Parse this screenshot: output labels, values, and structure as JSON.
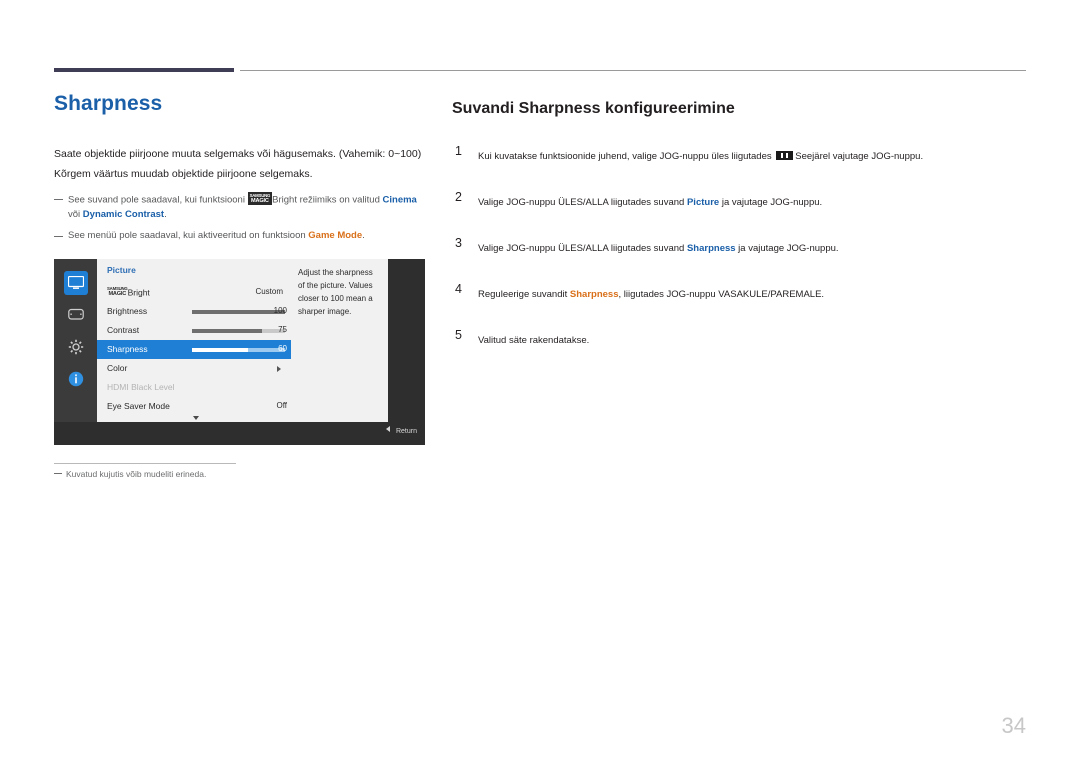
{
  "left": {
    "title": "Sharpness",
    "paragraphs": [
      "Saate objektide piirjoone muuta selgemaks või hägusemaks. (Vahemik: 0~100)",
      "Kõrgem väärtus muudab objektide piirjoone selgemaks."
    ],
    "notes": [
      {
        "pre": "See suvand pole saadaval, kui funktsiooni ",
        "tag_top": "SAMSUNG",
        "tag_bottom": "MAGIC",
        "mid": "Bright režiimiks on valitud ",
        "b1": "Cinema",
        "between": " või ",
        "b2": "Dynamic Contrast",
        "post": "."
      },
      {
        "pre": "See menüü pole saadaval, kui aktiveeritud on funktsioon ",
        "b1": "Game Mode",
        "post": "."
      }
    ],
    "footnote": "Kuvatud kujutis võib mudeliti erineda."
  },
  "osd": {
    "menu_title": "Picture",
    "icons": [
      {
        "name": "display-icon",
        "selected": true
      },
      {
        "name": "screen-adjust-icon",
        "selected": false
      },
      {
        "name": "gear-icon",
        "selected": false
      },
      {
        "name": "info-icon",
        "selected": false
      }
    ],
    "rows": [
      {
        "label_prefix_top": "SAMSUNG",
        "label_prefix_bottom": "MAGIC",
        "label": "Bright",
        "value": "Custom",
        "type": "text"
      },
      {
        "label": "Brightness",
        "value": "100",
        "type": "bar",
        "fill": 100
      },
      {
        "label": "Contrast",
        "value": "75",
        "type": "bar",
        "fill": 75
      },
      {
        "label": "Sharpness",
        "value": "60",
        "type": "bar",
        "fill": 60,
        "selected": true
      },
      {
        "label": "Color",
        "value": "",
        "type": "arrow"
      },
      {
        "label": "HDMI Black Level",
        "value": "",
        "type": "disabled"
      },
      {
        "label": "Eye Saver Mode",
        "value": "Off",
        "type": "text"
      }
    ],
    "help_text": "Adjust the sharpness of the picture. Values closer to 100 mean a sharper image.",
    "return_label": "Return"
  },
  "right": {
    "title": "Suvandi Sharpness konfigureerimine",
    "steps": [
      {
        "num": "1",
        "a": "Kui kuvatakse funktsioonide juhend, valige JOG-nuppu üles liigutades ",
        "b": "Seejärel vajutage JOG-nuppu."
      },
      {
        "num": "2",
        "a": "Valige JOG-nuppu ÜLES/ALLA liigutades suvand ",
        "bold": "Picture",
        "b": " ja vajutage JOG-nuppu."
      },
      {
        "num": "3",
        "a": "Valige JOG-nuppu ÜLES/ALLA liigutades suvand ",
        "bold": "Sharpness",
        "b": " ja vajutage JOG-nuppu."
      },
      {
        "num": "4",
        "a": "Reguleerige suvandit ",
        "bold": "Sharpness",
        "b": ", liigutades JOG-nuppu VASAKULE/PAREMALE."
      },
      {
        "num": "5",
        "a": "Valitud säte rakendatakse.",
        "bold": "",
        "b": ""
      }
    ]
  },
  "page_number": "34",
  "colors": {
    "title_blue": "#1a5fa8",
    "accent_bar": "#3f3d56",
    "osd_highlight": "#1f7fd4",
    "orange": "#d9701a"
  }
}
